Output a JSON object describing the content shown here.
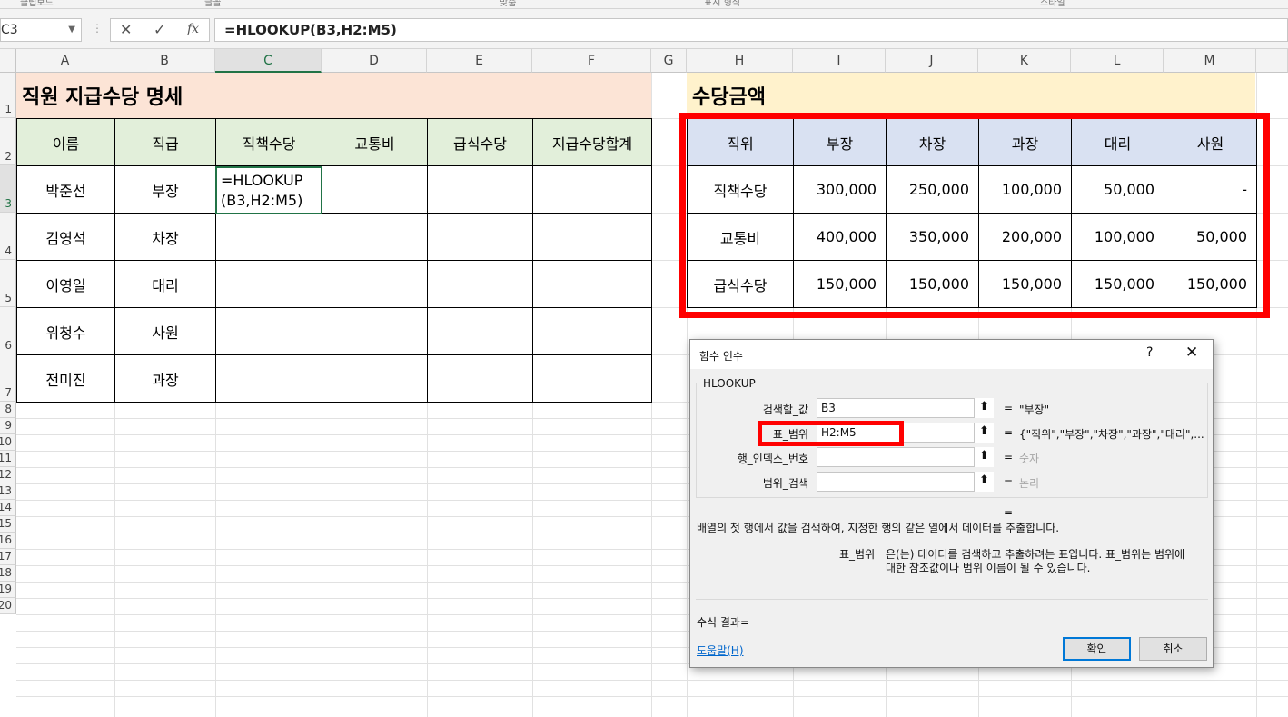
{
  "ribbon_labels": [
    "클립보드",
    "글꼴",
    "맞춤",
    "표시 형식",
    "스타일"
  ],
  "name_box": "C3",
  "formula_buttons": {
    "cancel": "✕",
    "enter": "✓",
    "fx": "fx"
  },
  "formula": "=HLOOKUP(B3,H2:M5)",
  "columns": [
    "A",
    "B",
    "C",
    "D",
    "E",
    "F",
    "G",
    "H",
    "I",
    "J",
    "K",
    "L",
    "M"
  ],
  "rows": [
    "1",
    "2",
    "3",
    "4",
    "5",
    "6",
    "7",
    "8",
    "9",
    "10",
    "11",
    "12",
    "13",
    "14",
    "15",
    "16",
    "17",
    "18",
    "19",
    "20"
  ],
  "left_table": {
    "title": "직원 지급수당 명세",
    "headers": [
      "이름",
      "직급",
      "직책수당",
      "교통비",
      "급식수당",
      "지급수당합계"
    ],
    "rows": [
      {
        "name": "박준선",
        "rank": "부장"
      },
      {
        "name": "김영석",
        "rank": "차장"
      },
      {
        "name": "이영일",
        "rank": "대리"
      },
      {
        "name": "위청수",
        "rank": "사원"
      },
      {
        "name": "전미진",
        "rank": "과장"
      }
    ],
    "active_cell_text": "=HLOOKUP(B3,H2:M5)"
  },
  "right_table": {
    "title": "수당금액",
    "headers": [
      "직위",
      "부장",
      "차장",
      "과장",
      "대리",
      "사원"
    ],
    "rows": [
      {
        "label": "직책수당",
        "values": [
          "300,000",
          "250,000",
          "100,000",
          "50,000",
          "-"
        ]
      },
      {
        "label": "교통비",
        "values": [
          "400,000",
          "350,000",
          "200,000",
          "100,000",
          "50,000"
        ]
      },
      {
        "label": "급식수당",
        "values": [
          "150,000",
          "150,000",
          "150,000",
          "150,000",
          "150,000"
        ]
      }
    ]
  },
  "dialog": {
    "title": "함수 인수",
    "help_q": "?",
    "close": "✕",
    "function_name": "HLOOKUP",
    "args": [
      {
        "label": "검색할_값",
        "value": "B3",
        "eq": "=",
        "result": "\"부장\""
      },
      {
        "label": "표_범위",
        "value": "H2:M5",
        "eq": "=",
        "result": "{\"직위\",\"부장\",\"차장\",\"과장\",\"대리\",..."
      },
      {
        "label": "행_인덱스_번호",
        "value": "",
        "eq": "=",
        "result": "숫자"
      },
      {
        "label": "범위_검색",
        "value": "",
        "eq": "=",
        "result": "논리"
      }
    ],
    "ref_btn": "⬆",
    "total_eq": "=",
    "description": "배열의 첫 행에서 값을 검색하여, 지정한 행의 같은 열에서 데이터를 추출합니다.",
    "arg_desc_label": "표_범위",
    "arg_desc_line1": "은(는) 데이터를 검색하고 추출하려는 표입니다. 표_범위는 범위에",
    "arg_desc_line2": "대한 참조값이나 범위 이름이 될 수 있습니다.",
    "formula_result": "수식 결과=",
    "help_link": "도움말(H)",
    "ok": "확인",
    "cancel": "취소"
  },
  "colors": {
    "accent_green": "#217346",
    "highlight_red": "#ff0000",
    "left_title_bg": "#fce4d6",
    "right_title_bg": "#fff2cc",
    "left_header_bg": "#e2efda",
    "right_header_bg": "#d9e1f2"
  }
}
